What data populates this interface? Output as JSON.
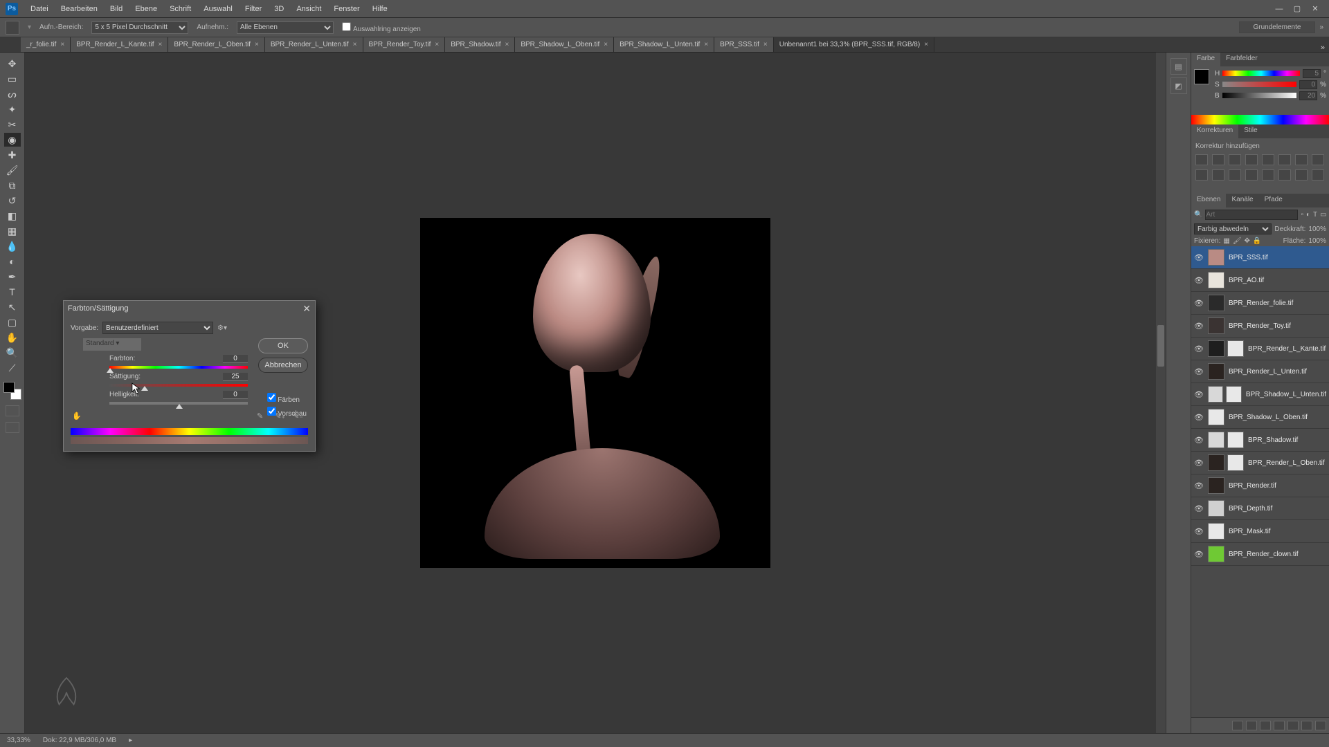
{
  "menubar": {
    "items": [
      "Datei",
      "Bearbeiten",
      "Bild",
      "Ebene",
      "Schrift",
      "Auswahl",
      "Filter",
      "3D",
      "Ansicht",
      "Fenster",
      "Hilfe"
    ]
  },
  "optionsbar": {
    "sample_area_label": "Aufn.-Bereich:",
    "sample_area_value": "5 x 5 Pixel Durchschnitt",
    "sample_layers_label": "Aufnehm.:",
    "sample_layers_value": "Alle Ebenen",
    "show_selection_label": "Auswahlring anzeigen",
    "workspace_label": "Grundelemente"
  },
  "tabs": [
    {
      "label": "_r_folie.tif"
    },
    {
      "label": "BPR_Render_L_Kante.tif"
    },
    {
      "label": "BPR_Render_L_Oben.tif"
    },
    {
      "label": "BPR_Render_L_Unten.tif"
    },
    {
      "label": "BPR_Render_Toy.tif"
    },
    {
      "label": "BPR_Shadow.tif"
    },
    {
      "label": "BPR_Shadow_L_Oben.tif"
    },
    {
      "label": "BPR_Shadow_L_Unten.tif"
    },
    {
      "label": "BPR_SSS.tif"
    },
    {
      "label": "Unbenannt1 bei 33,3% (BPR_SSS.tif, RGB/8)",
      "active": true
    }
  ],
  "tools": {
    "list": [
      "move",
      "marquee",
      "lasso",
      "wand",
      "crop",
      "eyedropper",
      "healing",
      "brush",
      "stamp",
      "history",
      "eraser",
      "gradient",
      "blur",
      "dodge",
      "pen",
      "type",
      "path",
      "rect",
      "hand",
      "zoom",
      "ruler"
    ]
  },
  "color_panel": {
    "tab1": "Farbe",
    "tab2": "Farbfelder",
    "h_label": "H",
    "s_label": "S",
    "b_label": "B",
    "h_unit": "°",
    "sb_unit": "%",
    "h_val": "5",
    "s_val": "0",
    "b_val": "20"
  },
  "adjustments": {
    "tab1": "Korrekturen",
    "tab2": "Stile",
    "hint": "Korrektur hinzufügen"
  },
  "layers_panel": {
    "tab1": "Ebenen",
    "tab2": "Kanäle",
    "tab3": "Pfade",
    "search_placeholder": "Art",
    "blend_mode": "Farbig abwedeln",
    "opacity_label": "Deckkraft:",
    "opacity_value": "100%",
    "lock_label": "Fixieren:",
    "fill_label": "Fläche:",
    "fill_value": "100%"
  },
  "layers": [
    {
      "name": "BPR_SSS.tif",
      "selected": true,
      "thumb": "#b98b84"
    },
    {
      "name": "BPR_AO.tif",
      "thumb": "#e8e4dc"
    },
    {
      "name": "BPR_Render_folie.tif",
      "thumb": "#2a2a2a"
    },
    {
      "name": "BPR_Render_Toy.tif",
      "thumb": "#3a3332"
    },
    {
      "name": "BPR_Render_L_Kante.tif",
      "thumb": "#1e1e1e",
      "mask": true
    },
    {
      "name": "BPR_Render_L_Unten.tif",
      "thumb": "#2a2320"
    },
    {
      "name": "BPR_Shadow_L_Unten.tif",
      "thumb": "#d8d8d8",
      "mask": true
    },
    {
      "name": "BPR_Shadow_L_Oben.tif",
      "thumb": "#e8e8e8"
    },
    {
      "name": "BPR_Shadow.tif",
      "thumb": "#d8d8d8",
      "mask": true
    },
    {
      "name": "BPR_Render_L_Oben.tif",
      "thumb": "#2a2320",
      "mask": true
    },
    {
      "name": "BPR_Render.tif",
      "thumb": "#2a2320"
    },
    {
      "name": "BPR_Depth.tif",
      "thumb": "#d0d0d0"
    },
    {
      "name": "BPR_Mask.tif",
      "thumb": "#e8e8e8"
    },
    {
      "name": "BPR_Render_clown.tif",
      "thumb": "#6fc934"
    }
  ],
  "dialog": {
    "title": "Farbton/Sättigung",
    "preset_label": "Vorgabe:",
    "preset_value": "Benutzerdefiniert",
    "ok": "OK",
    "cancel": "Abbrechen",
    "range": "Standard",
    "hue_label": "Farbton:",
    "hue_value": "0",
    "sat_label": "Sättigung:",
    "sat_value": "25",
    "lig_label": "Helligkeit:",
    "lig_value": "0",
    "colorize": "Färben",
    "preview": "Vorschau"
  },
  "status": {
    "zoom": "33,33%",
    "docinfo": "Dok: 22,9 MB/306,0 MB"
  }
}
